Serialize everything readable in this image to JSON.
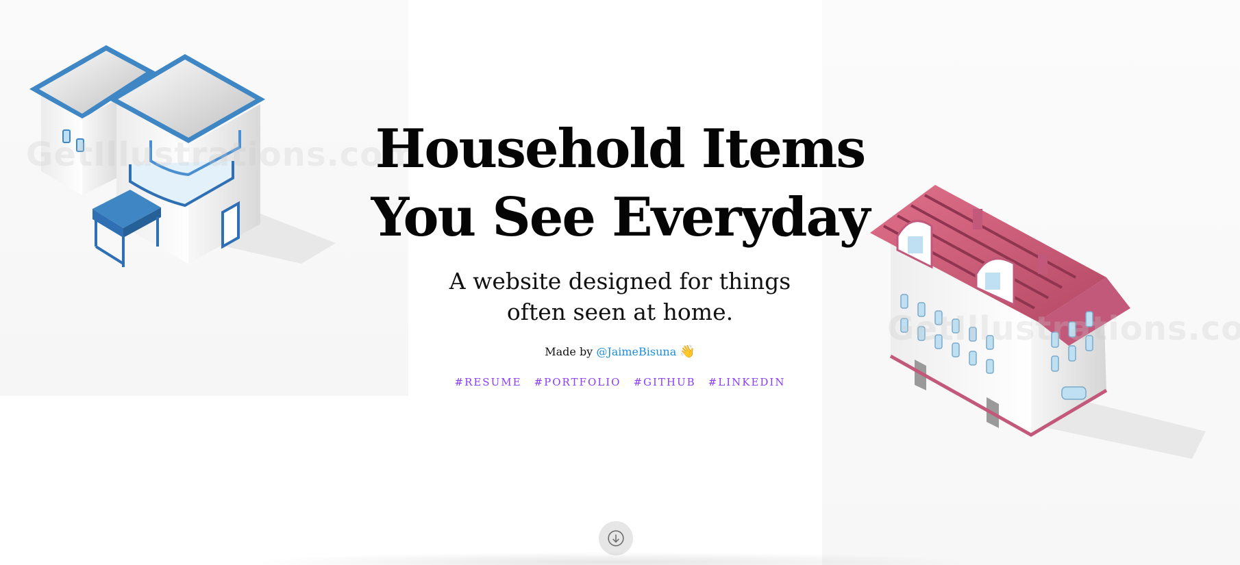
{
  "hero": {
    "title_line1": "Household Items",
    "title_line2": "You See Everyday",
    "subtitle_line1": "A website designed for things",
    "subtitle_line2": "often seen at home.",
    "credit_prefix": "Made by",
    "credit_handle": "@JaimeBisuna",
    "credit_emoji": "👋"
  },
  "links": [
    {
      "label": "#RESUME"
    },
    {
      "label": "#PORTFOLIO"
    },
    {
      "label": "#GITHUB"
    },
    {
      "label": "#LINKEDIN"
    }
  ],
  "watermark": "GetIllustrations.com",
  "icons": {
    "scroll": "arrow-down-circle-icon",
    "left_art": "blue-modern-house-illustration",
    "right_art": "pink-roof-house-illustration"
  },
  "colors": {
    "accent_link": "#8a3dfa",
    "handle_link": "#1a8fe0",
    "house_left_roof": "#3f87c4",
    "house_right_roof": "#d4607a"
  }
}
